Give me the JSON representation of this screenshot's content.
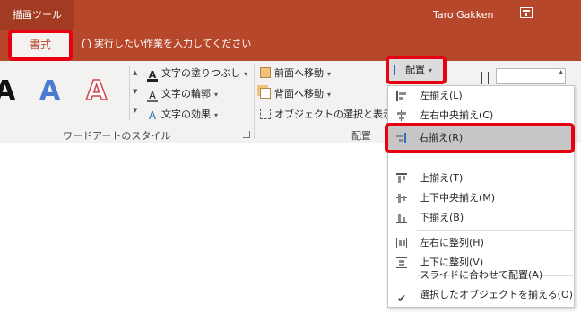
{
  "titlebar": {
    "context_label": "描画ツール",
    "user_name": "Taro Gakken"
  },
  "tabs": {
    "format_label": "書式",
    "tell_me": "実行したい作業を入力してください"
  },
  "ribbon": {
    "wordart_letter": "A",
    "text_fill": "文字の塗りつぶし",
    "text_outline": "文字の輪郭",
    "text_effects": "文字の効果",
    "wordart_group_label": "ワードアートのスタイル",
    "bring_forward": "前面へ移動",
    "send_backward": "背面へ移動",
    "selection_pane": "オブジェクトの選択と表示",
    "arrange_group_label": "配置",
    "arrange_button": "配置"
  },
  "menu": {
    "items": [
      {
        "label": "左揃え(L)",
        "icon": "align-left-icon"
      },
      {
        "label": "左右中央揃え(C)",
        "icon": "align-center-icon"
      },
      {
        "label": "右揃え(R)",
        "icon": "align-right-icon"
      },
      {
        "label": "上揃え(T)",
        "icon": "align-top-icon"
      },
      {
        "label": "上下中央揃え(M)",
        "icon": "align-middle-icon"
      },
      {
        "label": "下揃え(B)",
        "icon": "align-bottom-icon"
      },
      {
        "label": "左右に整列(H)",
        "icon": "distribute-horizontal-icon"
      },
      {
        "label": "上下に整列(V)",
        "icon": "distribute-vertical-icon"
      },
      {
        "label": "スライドに合わせて配置(A)",
        "icon": ""
      },
      {
        "label": "選択したオブジェクトを揃える(O)",
        "icon": "check-icon"
      }
    ]
  },
  "colors": {
    "accent": "#b7472a",
    "highlight_border": "#e60012"
  }
}
